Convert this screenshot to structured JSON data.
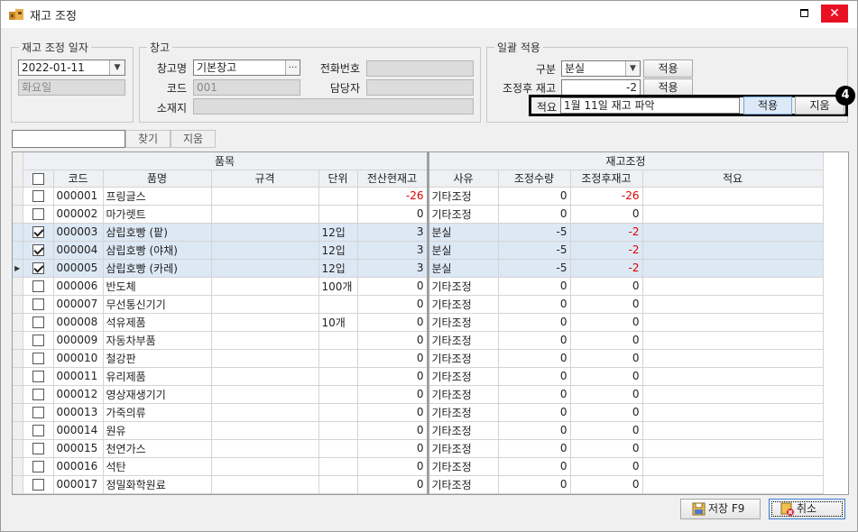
{
  "window": {
    "title": "재고 조정"
  },
  "adjust_date": {
    "legend": "재고 조정 일자",
    "date": "2022-01-11",
    "weekday": "화요일"
  },
  "warehouse": {
    "legend": "창고",
    "name_label": "창고명",
    "name_value": "기본창고",
    "code_label": "코드",
    "code_value": "001",
    "address_label": "소재지",
    "phone_label": "전화번호",
    "manager_label": "담당자"
  },
  "bulk": {
    "legend": "일괄 적용",
    "type_label": "구분",
    "type_value": "분실",
    "after_label": "조정후 재고",
    "after_value": "-2",
    "apply_label": "적용",
    "memo_label": "적요",
    "memo_value": "1월 11일 재고 파악",
    "clear_label": "지움",
    "badge": "4"
  },
  "search": {
    "find_label": "찾기",
    "clear_label": "지움"
  },
  "grid": {
    "group_item": "품목",
    "group_adjust": "재고조정",
    "columns": [
      "코드",
      "품명",
      "규격",
      "단위",
      "전산현재고",
      "사유",
      "조정수량",
      "조정후재고",
      "적요"
    ],
    "rows": [
      {
        "code": "000001",
        "name": "프링글스",
        "spec": "",
        "unit": "",
        "stock": "-26",
        "reason": "기타조정",
        "qty": "0",
        "after": "-26",
        "memo": "",
        "checked": false,
        "selected": false
      },
      {
        "code": "000002",
        "name": "마가렛트",
        "spec": "",
        "unit": "",
        "stock": "0",
        "reason": "기타조정",
        "qty": "0",
        "after": "0",
        "memo": "",
        "checked": false,
        "selected": false
      },
      {
        "code": "000003",
        "name": "삼립호빵 (팥)",
        "spec": "",
        "unit": "12입",
        "stock": "3",
        "reason": "분실",
        "qty": "-5",
        "after": "-2",
        "memo": "",
        "checked": true,
        "selected": true
      },
      {
        "code": "000004",
        "name": "삼립호빵 (야채)",
        "spec": "",
        "unit": "12입",
        "stock": "3",
        "reason": "분실",
        "qty": "-5",
        "after": "-2",
        "memo": "",
        "checked": true,
        "selected": true
      },
      {
        "code": "000005",
        "name": "삼립호빵 (카레)",
        "spec": "",
        "unit": "12입",
        "stock": "3",
        "reason": "분실",
        "qty": "-5",
        "after": "-2",
        "memo": "",
        "checked": true,
        "selected": true
      },
      {
        "code": "000006",
        "name": "반도체",
        "spec": "",
        "unit": "100개",
        "stock": "0",
        "reason": "기타조정",
        "qty": "0",
        "after": "0",
        "memo": "",
        "checked": false,
        "selected": false
      },
      {
        "code": "000007",
        "name": "무선통신기기",
        "spec": "",
        "unit": "",
        "stock": "0",
        "reason": "기타조정",
        "qty": "0",
        "after": "0",
        "memo": "",
        "checked": false,
        "selected": false
      },
      {
        "code": "000008",
        "name": "석유제품",
        "spec": "",
        "unit": "10개",
        "stock": "0",
        "reason": "기타조정",
        "qty": "0",
        "after": "0",
        "memo": "",
        "checked": false,
        "selected": false
      },
      {
        "code": "000009",
        "name": "자동차부품",
        "spec": "",
        "unit": "",
        "stock": "0",
        "reason": "기타조정",
        "qty": "0",
        "after": "0",
        "memo": "",
        "checked": false,
        "selected": false
      },
      {
        "code": "000010",
        "name": "철강판",
        "spec": "",
        "unit": "",
        "stock": "0",
        "reason": "기타조정",
        "qty": "0",
        "after": "0",
        "memo": "",
        "checked": false,
        "selected": false
      },
      {
        "code": "000011",
        "name": "유리제품",
        "spec": "",
        "unit": "",
        "stock": "0",
        "reason": "기타조정",
        "qty": "0",
        "after": "0",
        "memo": "",
        "checked": false,
        "selected": false
      },
      {
        "code": "000012",
        "name": "영상재생기기",
        "spec": "",
        "unit": "",
        "stock": "0",
        "reason": "기타조정",
        "qty": "0",
        "after": "0",
        "memo": "",
        "checked": false,
        "selected": false
      },
      {
        "code": "000013",
        "name": "가죽의류",
        "spec": "",
        "unit": "",
        "stock": "0",
        "reason": "기타조정",
        "qty": "0",
        "after": "0",
        "memo": "",
        "checked": false,
        "selected": false
      },
      {
        "code": "000014",
        "name": "원유",
        "spec": "",
        "unit": "",
        "stock": "0",
        "reason": "기타조정",
        "qty": "0",
        "after": "0",
        "memo": "",
        "checked": false,
        "selected": false
      },
      {
        "code": "000015",
        "name": "천연가스",
        "spec": "",
        "unit": "",
        "stock": "0",
        "reason": "기타조정",
        "qty": "0",
        "after": "0",
        "memo": "",
        "checked": false,
        "selected": false
      },
      {
        "code": "000016",
        "name": "석탄",
        "spec": "",
        "unit": "",
        "stock": "0",
        "reason": "기타조정",
        "qty": "0",
        "after": "0",
        "memo": "",
        "checked": false,
        "selected": false
      },
      {
        "code": "000017",
        "name": "정밀화학원료",
        "spec": "",
        "unit": "",
        "stock": "0",
        "reason": "기타조정",
        "qty": "0",
        "after": "0",
        "memo": "",
        "checked": false,
        "selected": false
      }
    ],
    "current_row_index": 4
  },
  "footer": {
    "save_label": "저장 F9",
    "cancel_label": "취소"
  },
  "colors": {
    "negative": "#e00000",
    "selected_row": "#dde8f5",
    "close_button": "#e81123"
  }
}
